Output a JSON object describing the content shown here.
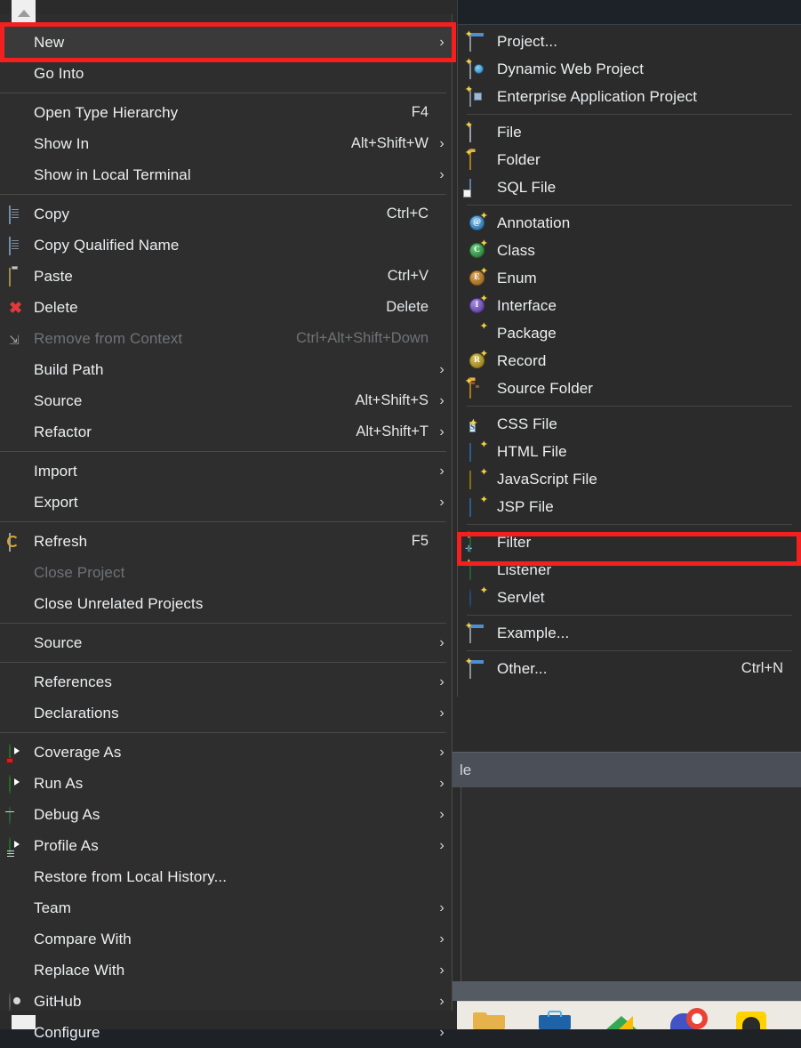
{
  "window": {
    "app": "Eclipse IDE",
    "panel_tab_label": "le",
    "scroll_up_icon": "triangle-up-icon",
    "scroll_down_icon": "scroll-down-button"
  },
  "annotations": [
    {
      "name": "new-highlight",
      "target": "New",
      "color": "#f42020"
    },
    {
      "name": "filter-highlight",
      "target": "Filter",
      "color": "#f42020"
    }
  ],
  "context_menu": {
    "groups": [
      {
        "items": [
          {
            "label": "New",
            "accel": "",
            "arrow": "›",
            "icon": "",
            "selected": true,
            "disabled": false
          },
          {
            "label": "Go Into",
            "accel": "",
            "arrow": "",
            "icon": "",
            "selected": false,
            "disabled": false
          }
        ]
      },
      {
        "items": [
          {
            "label": "Open Type Hierarchy",
            "accel": "F4",
            "arrow": "",
            "icon": "",
            "selected": false,
            "disabled": false
          },
          {
            "label": "Show In",
            "accel": "Alt+Shift+W",
            "arrow": "›",
            "icon": "",
            "selected": false,
            "disabled": false
          },
          {
            "label": "Show in Local Terminal",
            "accel": "",
            "arrow": "›",
            "icon": "",
            "selected": false,
            "disabled": false
          }
        ]
      },
      {
        "items": [
          {
            "label": "Copy",
            "accel": "Ctrl+C",
            "arrow": "",
            "icon": "copy-icon",
            "selected": false,
            "disabled": false
          },
          {
            "label": "Copy Qualified Name",
            "accel": "",
            "arrow": "",
            "icon": "copy-qualified-name-icon",
            "selected": false,
            "disabled": false
          },
          {
            "label": "Paste",
            "accel": "Ctrl+V",
            "arrow": "",
            "icon": "paste-icon",
            "selected": false,
            "disabled": false
          },
          {
            "label": "Delete",
            "accel": "Delete",
            "arrow": "",
            "icon": "delete-icon",
            "selected": false,
            "disabled": false
          },
          {
            "label": "Remove from Context",
            "accel": "Ctrl+Alt+Shift+Down",
            "arrow": "",
            "icon": "remove-from-context-icon",
            "selected": false,
            "disabled": true
          },
          {
            "label": "Build Path",
            "accel": "",
            "arrow": "›",
            "icon": "",
            "selected": false,
            "disabled": false
          },
          {
            "label": "Source",
            "accel": "Alt+Shift+S",
            "arrow": "›",
            "icon": "",
            "selected": false,
            "disabled": false
          },
          {
            "label": "Refactor",
            "accel": "Alt+Shift+T",
            "arrow": "›",
            "icon": "",
            "selected": false,
            "disabled": false
          }
        ]
      },
      {
        "items": [
          {
            "label": "Import",
            "accel": "",
            "arrow": "›",
            "icon": "",
            "selected": false,
            "disabled": false
          },
          {
            "label": "Export",
            "accel": "",
            "arrow": "›",
            "icon": "",
            "selected": false,
            "disabled": false
          }
        ]
      },
      {
        "items": [
          {
            "label": "Refresh",
            "accel": "F5",
            "arrow": "",
            "icon": "refresh-icon",
            "selected": false,
            "disabled": false
          },
          {
            "label": "Close Project",
            "accel": "",
            "arrow": "",
            "icon": "",
            "selected": false,
            "disabled": true
          },
          {
            "label": "Close Unrelated Projects",
            "accel": "",
            "arrow": "",
            "icon": "",
            "selected": false,
            "disabled": false
          }
        ]
      },
      {
        "items": [
          {
            "label": "Source",
            "accel": "",
            "arrow": "›",
            "icon": "",
            "selected": false,
            "disabled": false
          }
        ]
      },
      {
        "items": [
          {
            "label": "References",
            "accel": "",
            "arrow": "›",
            "icon": "",
            "selected": false,
            "disabled": false
          },
          {
            "label": "Declarations",
            "accel": "",
            "arrow": "›",
            "icon": "",
            "selected": false,
            "disabled": false
          }
        ]
      },
      {
        "items": [
          {
            "label": "Coverage As",
            "accel": "",
            "arrow": "›",
            "icon": "coverage-as-icon",
            "selected": false,
            "disabled": false
          },
          {
            "label": "Run As",
            "accel": "",
            "arrow": "›",
            "icon": "run-as-icon",
            "selected": false,
            "disabled": false
          },
          {
            "label": "Debug As",
            "accel": "",
            "arrow": "›",
            "icon": "debug-as-icon",
            "selected": false,
            "disabled": false
          },
          {
            "label": "Profile As",
            "accel": "",
            "arrow": "›",
            "icon": "profile-as-icon",
            "selected": false,
            "disabled": false
          },
          {
            "label": "Restore from Local History...",
            "accel": "",
            "arrow": "",
            "icon": "",
            "selected": false,
            "disabled": false
          },
          {
            "label": "Team",
            "accel": "",
            "arrow": "›",
            "icon": "",
            "selected": false,
            "disabled": false
          },
          {
            "label": "Compare With",
            "accel": "",
            "arrow": "›",
            "icon": "",
            "selected": false,
            "disabled": false
          },
          {
            "label": "Replace With",
            "accel": "",
            "arrow": "›",
            "icon": "",
            "selected": false,
            "disabled": false
          },
          {
            "label": "GitHub",
            "accel": "",
            "arrow": "›",
            "icon": "github-icon",
            "selected": false,
            "disabled": false
          },
          {
            "label": "Configure",
            "accel": "",
            "arrow": "›",
            "icon": "",
            "selected": false,
            "disabled": false
          }
        ]
      }
    ]
  },
  "new_submenu": {
    "title": "New",
    "groups": [
      {
        "items": [
          {
            "label": "Project...",
            "accel": "",
            "icon": "project-icon",
            "highlighted": false
          },
          {
            "label": "Dynamic Web Project",
            "accel": "",
            "icon": "dynamic-web-project-icon",
            "highlighted": false
          },
          {
            "label": "Enterprise Application Project",
            "accel": "",
            "icon": "enterprise-application-project-icon",
            "highlighted": false
          }
        ]
      },
      {
        "items": [
          {
            "label": "File",
            "accel": "",
            "icon": "file-icon",
            "highlighted": false
          },
          {
            "label": "Folder",
            "accel": "",
            "icon": "folder-icon",
            "highlighted": false
          },
          {
            "label": "SQL File",
            "accel": "",
            "icon": "sql-file-icon",
            "highlighted": false
          }
        ]
      },
      {
        "items": [
          {
            "label": "Annotation",
            "accel": "",
            "icon": "annotation-icon",
            "highlighted": false
          },
          {
            "label": "Class",
            "accel": "",
            "icon": "class-icon",
            "highlighted": false
          },
          {
            "label": "Enum",
            "accel": "",
            "icon": "enum-icon",
            "highlighted": false
          },
          {
            "label": "Interface",
            "accel": "",
            "icon": "interface-icon",
            "highlighted": false
          },
          {
            "label": "Package",
            "accel": "",
            "icon": "package-icon",
            "highlighted": false
          },
          {
            "label": "Record",
            "accel": "",
            "icon": "record-icon",
            "highlighted": false
          },
          {
            "label": "Source Folder",
            "accel": "",
            "icon": "source-folder-icon",
            "highlighted": false
          }
        ]
      },
      {
        "items": [
          {
            "label": "CSS File",
            "accel": "",
            "icon": "css-file-icon",
            "highlighted": false
          },
          {
            "label": "HTML File",
            "accel": "",
            "icon": "html-file-icon",
            "highlighted": false
          },
          {
            "label": "JavaScript File",
            "accel": "",
            "icon": "javascript-file-icon",
            "highlighted": false
          },
          {
            "label": "JSP File",
            "accel": "",
            "icon": "jsp-file-icon",
            "highlighted": false
          }
        ]
      },
      {
        "items": [
          {
            "label": "Filter",
            "accel": "",
            "icon": "filter-icon",
            "highlighted": true
          },
          {
            "label": "Listener",
            "accel": "",
            "icon": "listener-icon",
            "highlighted": false
          },
          {
            "label": "Servlet",
            "accel": "",
            "icon": "servlet-icon",
            "highlighted": false
          }
        ]
      },
      {
        "items": [
          {
            "label": "Example...",
            "accel": "",
            "icon": "example-icon",
            "highlighted": false
          }
        ]
      },
      {
        "items": [
          {
            "label": "Other...",
            "accel": "Ctrl+N",
            "icon": "other-icon",
            "highlighted": false
          }
        ]
      }
    ]
  },
  "taskbar": {
    "icons": [
      "folder-icon",
      "toolbox-icon",
      "drive-icon",
      "chrome-icon",
      "yellow-app-icon",
      "purple-app-icon"
    ]
  }
}
